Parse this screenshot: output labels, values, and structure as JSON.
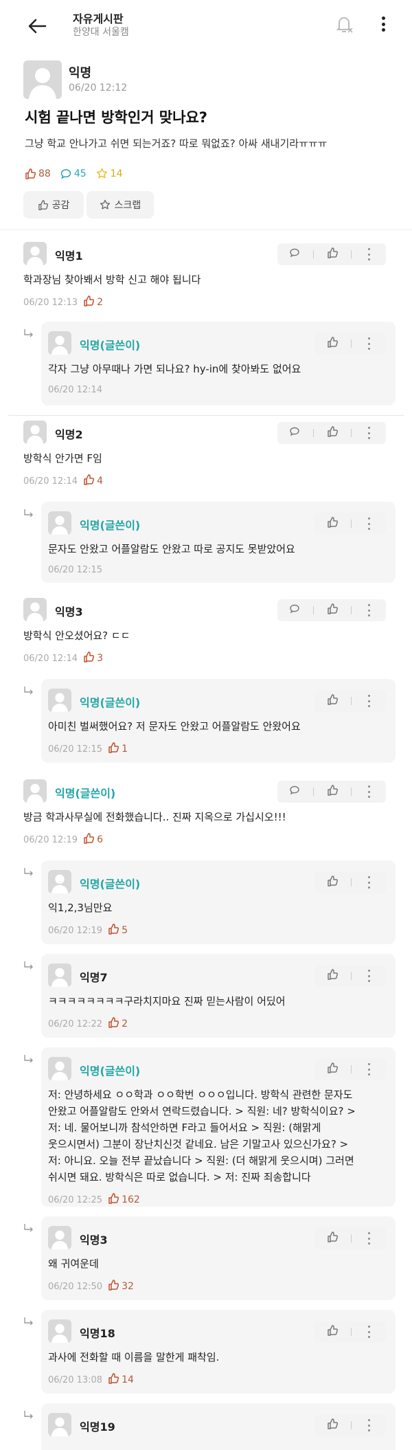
{
  "header": {
    "board": "자유게시판",
    "school": "한양대 서울캠"
  },
  "post": {
    "author": "익명",
    "date": "06/20 12:12",
    "title": "시험 끝나면 방학인거 맞나요?",
    "body": "그냥 학교 안나가고 쉬면 되는거죠? 따로 뭐없죠? 아싸 새내기라ㅠㅠㅠ",
    "likes": "88",
    "comments": "45",
    "scraps": "14",
    "like_button": "공감",
    "scrap_button": "스크랩"
  },
  "comments": [
    {
      "name": "익명1",
      "text": "학과장님 찾아봬서 방학 신고 해야 됩니다",
      "date": "06/20 12:13",
      "likes": "2"
    },
    {
      "name": "익명(글쓴이)",
      "text": "각자 그냥 아무때나 가면 되나요? hy-in에 찾아봐도 없어요",
      "date": "06/20 12:14",
      "likes": ""
    },
    {
      "name": "익명2",
      "text": "방학식 안가면 F임",
      "date": "06/20 12:14",
      "likes": "4"
    },
    {
      "name": "익명(글쓴이)",
      "text": "문자도 안왔고 어플알람도 안왔고 따로 공지도 못받았어요",
      "date": "06/20 12:15",
      "likes": ""
    },
    {
      "name": "익명3",
      "text": "방학식 안오셨어요? ㄷㄷ",
      "date": "06/20 12:14",
      "likes": "3"
    },
    {
      "name": "익명(글쓴이)",
      "text": "아미친 벌써했어요? 저 문자도 안왔고 어플알람도 안왔어요",
      "date": "06/20 12:15",
      "likes": "1"
    },
    {
      "name": "익명(글쓴이)",
      "text": "방금 학과사무실에 전화했습니다.. 진짜 지옥으로 가십시오!!!",
      "date": "06/20 12:19",
      "likes": "6"
    },
    {
      "name": "익명(글쓴이)",
      "text": "익1,2,3님만요",
      "date": "06/20 12:19",
      "likes": "5"
    },
    {
      "name": "익명7",
      "text": "ㅋㅋㅋㅋㅋㅋㅋㅋ구라치지마요 진짜 믿는사람이 어딨어",
      "date": "06/20 12:22",
      "likes": "2"
    },
    {
      "name": "익명(글쓴이)",
      "text_lines": [
        "저: 안녕하세요 ㅇㅇ학과 ㅇㅇ학번 ㅇㅇㅇ입니다. 방학식 관련한 문자도",
        "안왔고 어플알람도 안와서 연락드렸습니다. > 직원: 네? 방학식이요? >",
        "저: 네. 물어보니까 참석안하면 F라고 들어서요 > 직원: (해맑게",
        "웃으시면서) 그분이 장난치신것 같네요. 남은 기말고사 있으신가요? >",
        "저: 아니요. 오늘 전부 끝났습니다 > 직원: (더 해맑게 웃으시며) 그러면",
        "쉬시면 돼요. 방학식은 따로 없습니다. > 저: 진짜 죄송합니다"
      ],
      "date": "06/20 12:25",
      "likes": "162"
    },
    {
      "name": "익명3",
      "text": "왜 귀여운데",
      "date": "06/20 12:50",
      "likes": "32"
    },
    {
      "name": "익명18",
      "text": "과사에 전화할 때 이름을 말한게 패착임.",
      "date": "06/20 13:08",
      "likes": "14"
    },
    {
      "name": "익명19",
      "text": "",
      "date": "",
      "likes": ""
    }
  ],
  "colors": {
    "op": "#22a6a6",
    "like": "#b05a3a",
    "comment": "#2aa3b8",
    "scrap": "#e6c12e"
  }
}
